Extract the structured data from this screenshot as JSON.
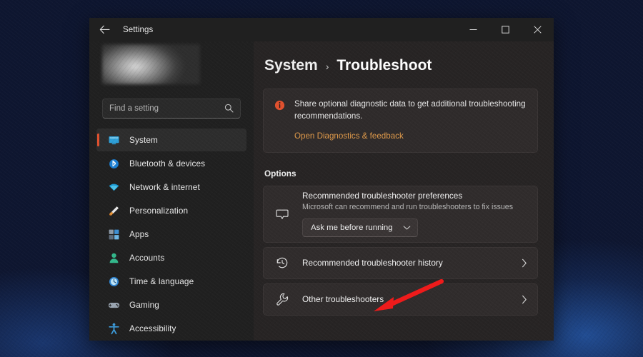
{
  "window": {
    "app_title": "Settings",
    "back_icon": "back-arrow-icon",
    "controls": {
      "minimize": "minimize-icon",
      "maximize": "maximize-icon",
      "close": "close-icon"
    }
  },
  "sidebar": {
    "profile": "blurred-user-account-block",
    "search": {
      "placeholder": "Find a setting",
      "value": "",
      "icon": "search-icon"
    },
    "items": [
      {
        "label": "System",
        "icon": "monitor-icon",
        "selected": true
      },
      {
        "label": "Bluetooth & devices",
        "icon": "bluetooth-icon",
        "selected": false
      },
      {
        "label": "Network & internet",
        "icon": "wifi-icon",
        "selected": false
      },
      {
        "label": "Personalization",
        "icon": "paintbrush-icon",
        "selected": false
      },
      {
        "label": "Apps",
        "icon": "apps-grid-icon",
        "selected": false
      },
      {
        "label": "Accounts",
        "icon": "person-icon",
        "selected": false
      },
      {
        "label": "Time & language",
        "icon": "clock-icon",
        "selected": false
      },
      {
        "label": "Gaming",
        "icon": "game-controller-icon",
        "selected": false
      },
      {
        "label": "Accessibility",
        "icon": "accessibility-person-icon",
        "selected": false
      }
    ]
  },
  "main": {
    "breadcrumb": {
      "parent": "System",
      "separator": "›",
      "current": "Troubleshoot"
    },
    "banner": {
      "icon": "info-circle-icon",
      "text": "Share optional diagnostic data to get additional troubleshooting recommendations.",
      "link": "Open Diagnostics & feedback",
      "link_color": "#e09a4a",
      "icon_color": "#e2512e"
    },
    "section_title": "Options",
    "cards": [
      {
        "title": "Recommended troubleshooter preferences",
        "subtitle": "Microsoft can recommend and run troubleshooters to fix issues",
        "icon": "speech-bubble-icon",
        "dropdown": {
          "value": "Ask me before running",
          "chevron": "chevron-down-icon"
        }
      },
      {
        "title": "Recommended troubleshooter history",
        "icon": "history-clock-icon",
        "chevron": "chevron-right-icon"
      },
      {
        "title": "Other troubleshooters",
        "icon": "wrench-icon",
        "chevron": "chevron-right-icon"
      }
    ]
  },
  "annotation": {
    "arrow": "red-pointer-arrow",
    "color": "#ee1b1b",
    "points_to": "Other troubleshooters"
  }
}
